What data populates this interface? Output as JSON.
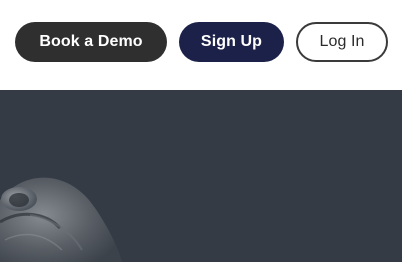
{
  "header": {
    "buttons": {
      "book_demo": "Book a Demo",
      "sign_up": "Sign Up",
      "log_in": "Log In"
    }
  },
  "hero": {
    "background_color": "#343b45",
    "image": "partial-object-image"
  },
  "colors": {
    "book_demo_bg": "#2f2f2f",
    "sign_up_bg": "#1b2148",
    "log_in_border": "#3a3a3a"
  }
}
